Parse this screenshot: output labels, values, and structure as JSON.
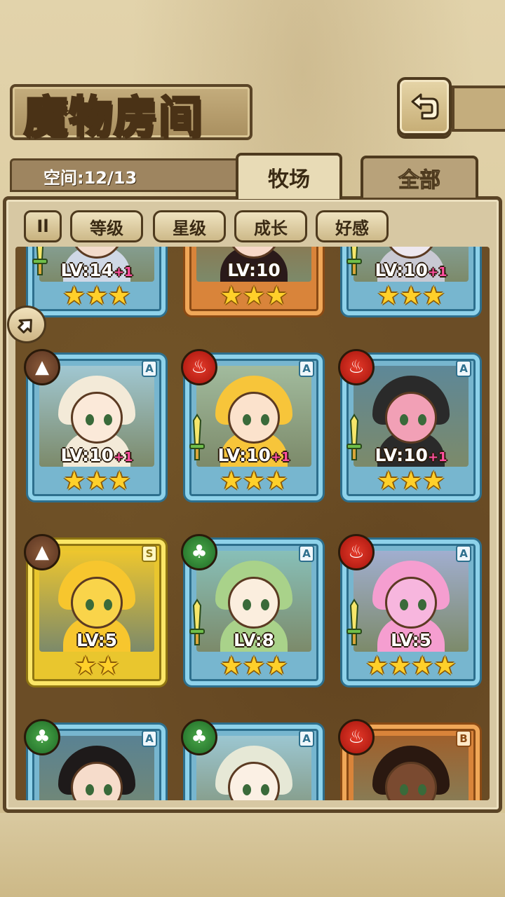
{
  "header": {
    "title": "魔物房间",
    "capacity": "空间:12/13"
  },
  "tabs": [
    {
      "label": "牧场",
      "active": true
    },
    {
      "label": "全部",
      "active": false
    }
  ],
  "sort": {
    "toggle_label": "Il",
    "buttons": [
      "等级",
      "星级",
      "成长",
      "好感"
    ]
  },
  "colors": {
    "frame": "#5a4426",
    "card_blue": "#8ed2ea",
    "card_orange": "#f0a758",
    "card_gold": "#fbe667",
    "star": "#ffd02a",
    "bonus": "#ff4fa0"
  },
  "monsters": [
    {
      "level": "LV:14",
      "bonus": "+1",
      "stars": 3,
      "rarity": "",
      "element": "",
      "frame": "blue",
      "weapon": true,
      "hair": "#cfd8e6",
      "skin": "#f3dccc"
    },
    {
      "level": "LV:10",
      "bonus": "",
      "stars": 3,
      "rarity": "",
      "element": "",
      "frame": "orange",
      "weapon": false,
      "hair": "#2a1a1a",
      "skin": "#f7d8c8"
    },
    {
      "level": "LV:10",
      "bonus": "+1",
      "stars": 3,
      "rarity": "",
      "element": "",
      "frame": "blue",
      "weapon": true,
      "hair": "#c9c9d3",
      "skin": "#eee8ef"
    },
    {
      "level": "LV:10",
      "bonus": "+1",
      "stars": 3,
      "rarity": "A",
      "element": "earth",
      "frame": "blue",
      "weapon": false,
      "hair": "#f3ead8",
      "skin": "#fbe9d9"
    },
    {
      "level": "LV:10",
      "bonus": "+1",
      "stars": 3,
      "rarity": "A",
      "element": "fire",
      "frame": "blue",
      "weapon": true,
      "hair": "#f7c53a",
      "skin": "#fbe2cc"
    },
    {
      "level": "LV:10",
      "bonus": "+1",
      "stars": 3,
      "rarity": "A",
      "element": "fire",
      "frame": "blue",
      "weapon": true,
      "hair": "#2a2a2a",
      "skin": "#f2a0b6"
    },
    {
      "level": "LV:5",
      "bonus": "",
      "stars": 2,
      "rarity": "S",
      "element": "earth",
      "frame": "gold",
      "weapon": false,
      "hair": "#f7c62e",
      "skin": "#f9d44a"
    },
    {
      "level": "LV:8",
      "bonus": "",
      "stars": 3,
      "rarity": "A",
      "element": "wood",
      "frame": "blue",
      "weapon": true,
      "hair": "#a9d28a",
      "skin": "#fbeede"
    },
    {
      "level": "LV:5",
      "bonus": "",
      "stars": 4,
      "rarity": "A",
      "element": "fire",
      "frame": "blue",
      "weapon": true,
      "hair": "#f59ed0",
      "skin": "#f7b6de"
    },
    {
      "level": "",
      "bonus": "",
      "stars": 0,
      "rarity": "A",
      "element": "wood",
      "frame": "blue",
      "weapon": false,
      "hair": "#1e1a1a",
      "skin": "#f6dccb"
    },
    {
      "level": "",
      "bonus": "",
      "stars": 0,
      "rarity": "A",
      "element": "wood",
      "frame": "blue",
      "weapon": false,
      "hair": "#e6e8d6",
      "skin": "#fbf0e4"
    },
    {
      "level": "",
      "bonus": "",
      "stars": 0,
      "rarity": "B",
      "element": "fire",
      "frame": "orange",
      "weapon": false,
      "hair": "#2a1810",
      "skin": "#7a4a30"
    }
  ]
}
